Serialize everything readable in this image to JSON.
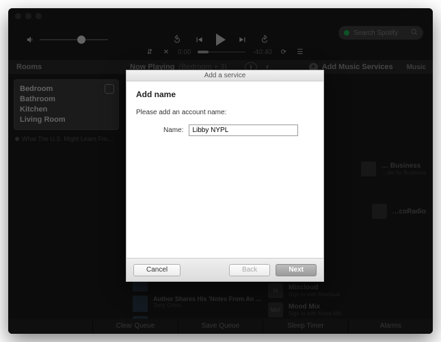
{
  "traffic_lights": [
    "close",
    "minimize",
    "zoom"
  ],
  "player": {
    "volume_pct": 55,
    "rewind15_icon": "replay-15-icon",
    "prev_icon": "prev-track-icon",
    "play_icon": "play-icon",
    "next_icon": "next-track-icon",
    "forward30_icon": "forward-30-icon"
  },
  "search": {
    "placeholder": "Search Spotify"
  },
  "row2": {
    "crossfade_icon": "crossfade-icon",
    "shuffle_icon": "shuffle-icon",
    "elapsed": "0:00",
    "remaining": "-40:40",
    "repeat_icon": "repeat-icon",
    "queue_icon": "queue-icon"
  },
  "headers": {
    "rooms": "Rooms",
    "now_playing": "Now Playing",
    "now_playing_sub": "(Bedroom + 3)",
    "info_symbol": "i",
    "back_symbol": "‹",
    "add_services": "Add Music Services",
    "music": "Music"
  },
  "rooms": {
    "items": [
      "Bedroom",
      "Bathroom",
      "Kitchen",
      "Living Room"
    ],
    "track_hint": "What The U.S. Might Learn From Chi…"
  },
  "right_services": [
    {
      "name": "… Business",
      "sub": "…dio for Business",
      "thumb": ""
    },
    {
      "name": "…coRadio",
      "sub": "",
      "thumb": ""
    },
    {
      "name": "Mixcloud",
      "sub": "Sign in with Mixcloud",
      "thumb": "M"
    },
    {
      "name": "Mood Mix",
      "sub": "Sign in with Mood Mix",
      "thumb": "MIX"
    }
  ],
  "queue": [
    {
      "title": "…",
      "artist": ""
    },
    {
      "title": "Author Shares His 'Notes From An Apocal…",
      "artist": "Terry Gross"
    },
    {
      "title": "…",
      "artist": ""
    }
  ],
  "bottom": {
    "clear_queue": "Clear Queue",
    "save_queue": "Save Queue",
    "sleep_timer": "Sleep Timer",
    "alarms": "Alarms"
  },
  "modal": {
    "title_bar": "Add a service",
    "heading": "Add name",
    "instruction": "Please add an account name:",
    "name_label": "Name:",
    "name_value": "Libby NYPL",
    "cancel": "Cancel",
    "back": "Back",
    "next": "Next"
  }
}
